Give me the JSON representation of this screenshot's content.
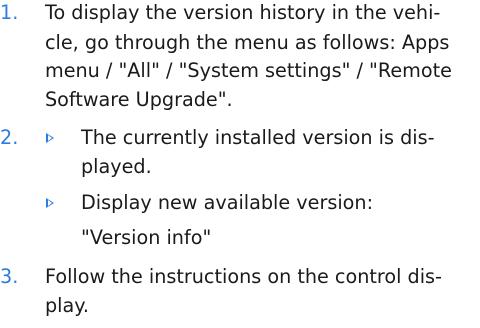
{
  "steps": [
    {
      "number": "1.",
      "lines": [
        "To display the version history in the vehi-",
        "cle, go through the menu as follows: Apps",
        "menu / \"All\" / \"System settings\" / \"Remote",
        "Software Upgrade\"."
      ]
    },
    {
      "number": "2.",
      "bullets": [
        {
          "lines": [
            "The currently installed version is dis-",
            "played."
          ]
        },
        {
          "lines": [
            "Display new available version:"
          ]
        }
      ],
      "continuation": "\"Version info\""
    },
    {
      "number": "3.",
      "lines": [
        "Follow the instructions on the control dis-",
        "play."
      ]
    }
  ],
  "colors": {
    "accent": "#2b7de0",
    "text": "#1a1a1a"
  }
}
